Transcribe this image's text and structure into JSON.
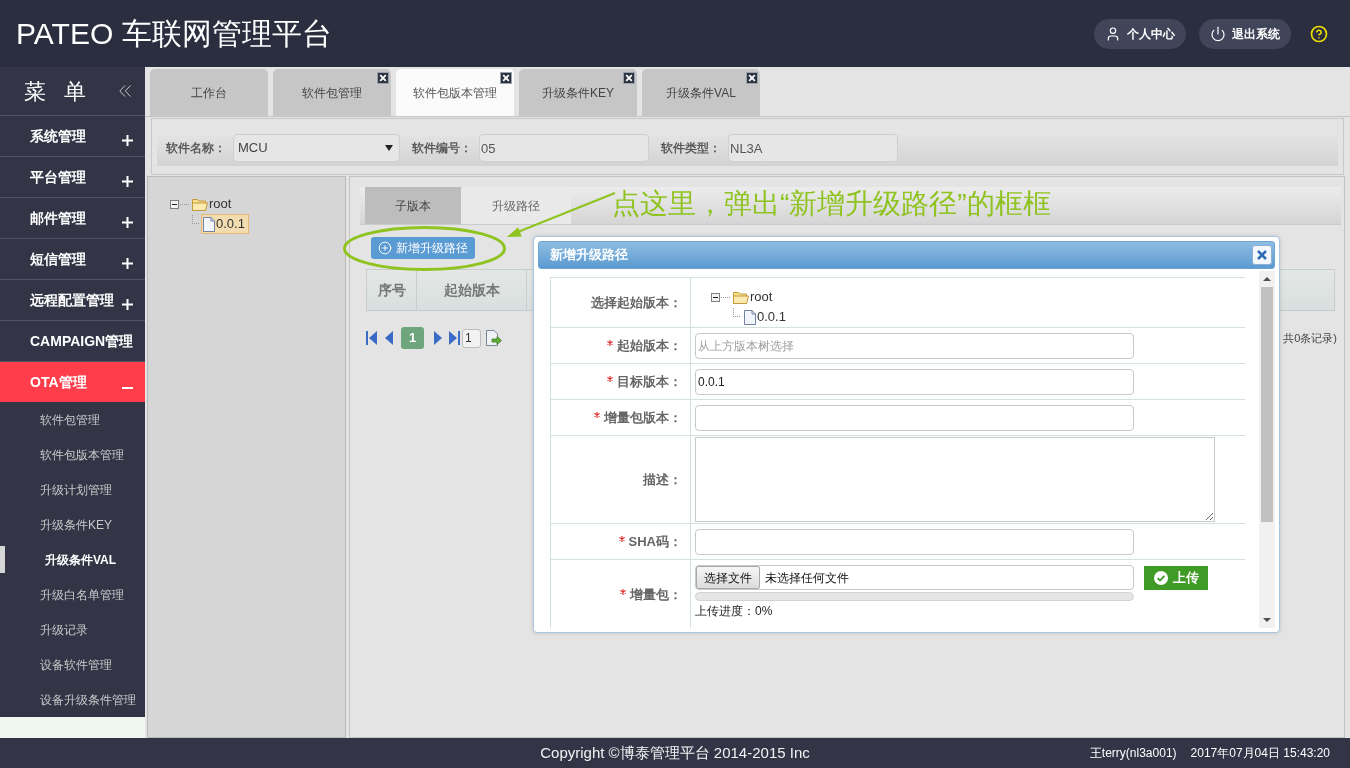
{
  "header": {
    "title": "PATEO 车联网管理平台",
    "buttons": [
      {
        "label": "个人中心",
        "kind": "user"
      },
      {
        "label": "退出系统",
        "kind": "power"
      }
    ]
  },
  "sidebar": {
    "title": "菜 单",
    "groups": [
      {
        "label": "系统管理",
        "kind": "group",
        "expanded": false
      },
      {
        "label": "平台管理",
        "kind": "group",
        "expanded": false
      },
      {
        "label": "邮件管理",
        "kind": "group",
        "expanded": false
      },
      {
        "label": "短信管理",
        "kind": "group",
        "expanded": false
      },
      {
        "label": "远程配置管理",
        "kind": "group",
        "expanded": false
      },
      {
        "label": "CAMPAIGN管理",
        "kind": "link",
        "expanded": false
      },
      {
        "label": "OTA管理",
        "kind": "group",
        "expanded": true,
        "children": [
          {
            "label": "软件包管理",
            "selected": false
          },
          {
            "label": "软件包版本管理",
            "selected": false
          },
          {
            "label": "升级计划管理",
            "selected": false
          },
          {
            "label": "升级条件KEY",
            "selected": false
          },
          {
            "label": "升级条件VAL",
            "selected": true
          },
          {
            "label": "升级白名单管理",
            "selected": false
          },
          {
            "label": "升级记录",
            "selected": false
          },
          {
            "label": "设备软件管理",
            "selected": false
          },
          {
            "label": "设备升级条件管理",
            "selected": false
          }
        ]
      }
    ]
  },
  "tabs": [
    {
      "label": "工作台",
      "selected": false,
      "closable": false
    },
    {
      "label": "软件包管理",
      "selected": false,
      "closable": true
    },
    {
      "label": "软件包版本管理",
      "selected": true,
      "closable": true
    },
    {
      "label": "升级条件KEY",
      "selected": false,
      "closable": true
    },
    {
      "label": "升级条件VAL",
      "selected": false,
      "closable": true
    }
  ],
  "filter": {
    "fields": [
      {
        "label": "软件名称：",
        "kind": "select",
        "value": "MCU"
      },
      {
        "label": "软件编号：",
        "kind": "text",
        "value": "05"
      },
      {
        "label": "软件类型：",
        "kind": "text",
        "value": "NL3A"
      }
    ]
  },
  "version_tree": [
    {
      "label": "root",
      "kind": "folder",
      "expanded": true,
      "selected": false,
      "children": [
        {
          "label": "0.0.1",
          "kind": "file",
          "selected": true
        }
      ]
    }
  ],
  "subtabs": [
    {
      "label": "子版本",
      "selected": true
    },
    {
      "label": "升级路径",
      "selected": false
    }
  ],
  "annotation": {
    "text": "点这里，弹出“新增升级路径”的框框"
  },
  "add_button": {
    "label": "新增升级路径"
  },
  "table": {
    "columns": [
      "序号",
      "起始版本"
    ]
  },
  "pagination": {
    "pages": [
      {
        "label": "1",
        "selected": true
      }
    ],
    "page_input": "1",
    "summary": "共0条记录)"
  },
  "dialog": {
    "title": "新增升级路径",
    "rows": [
      {
        "label": "选择起始版本：",
        "kind": "tree",
        "required": false,
        "tree": [
          {
            "label": "root",
            "kind": "folder",
            "expanded": true,
            "selected": false,
            "children": [
              {
                "label": "0.0.1",
                "kind": "file",
                "selected": false
              }
            ]
          }
        ]
      },
      {
        "label": "起始版本：",
        "kind": "input",
        "required": true,
        "placeholder": "从上方版本树选择"
      },
      {
        "label": "目标版本：",
        "kind": "input",
        "required": true,
        "value": "0.0.1"
      },
      {
        "label": "增量包版本：",
        "kind": "input",
        "required": true
      },
      {
        "label": "描述：",
        "kind": "textarea",
        "required": false
      },
      {
        "label": "SHA码：",
        "kind": "input",
        "required": true
      },
      {
        "label": "增量包：",
        "kind": "file",
        "required": true,
        "button": "选择文件",
        "file_status": "未选择任何文件",
        "upload": "上传",
        "progress_label": "上传进度：0%"
      }
    ]
  },
  "footer": {
    "copyright": "Copyright ©博泰管理平台 2014-2015 Inc",
    "user": "王terry(nl3a001)",
    "datetime": "2017年07月04日 15:43:20"
  }
}
